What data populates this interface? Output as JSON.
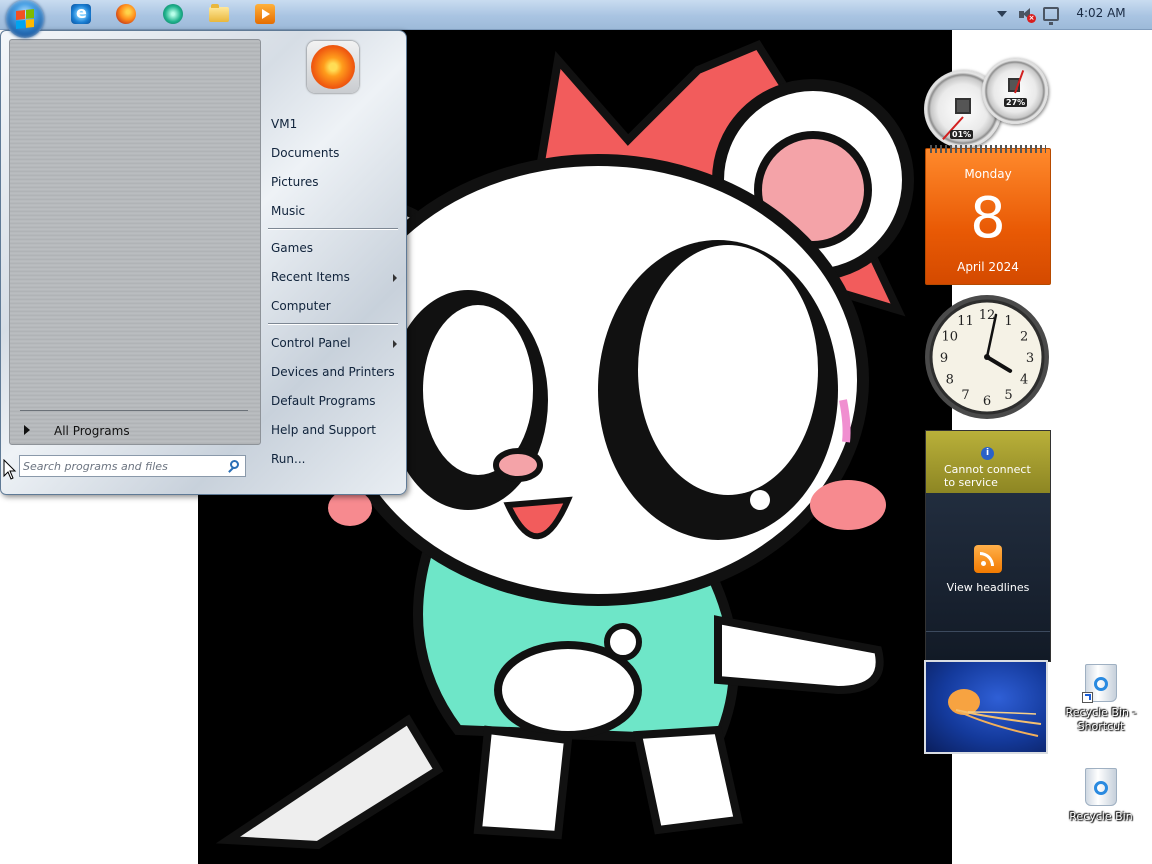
{
  "taskbar": {
    "pinned_icons": [
      "internet-explorer-icon",
      "firefox-icon",
      "media-player-icon",
      "windows-explorer-icon",
      "video-player-icon"
    ],
    "tray_icons": [
      "show-hidden-icons-chevron",
      "speaker-muted-icon",
      "network-icon"
    ],
    "clock": "4:02 AM"
  },
  "start_menu": {
    "all_programs": "All Programs",
    "search_placeholder": "Search programs and files",
    "right_items": [
      {
        "label": "VM1"
      },
      {
        "label": "Documents"
      },
      {
        "label": "Pictures"
      },
      {
        "label": "Music"
      },
      {
        "label": "Games"
      },
      {
        "label": "Recent Items",
        "submenu": true
      },
      {
        "label": "Computer"
      },
      {
        "label": "Control Panel",
        "submenu": true
      },
      {
        "label": "Devices and Printers"
      },
      {
        "label": "Default Programs"
      },
      {
        "label": "Help and Support"
      },
      {
        "label": "Run..."
      }
    ]
  },
  "gadgets": {
    "cpu_meter": {
      "cpu_percent": "01%",
      "memory_percent": "27%"
    },
    "calendar": {
      "day_name": "Monday",
      "day": "8",
      "month_year": "April 2024"
    },
    "clock": {
      "hour": 4,
      "minute": 2
    },
    "feeds": {
      "error": "Cannot connect to service",
      "headlines": "View headlines"
    }
  },
  "desktop_icons": [
    {
      "label": "Recycle Bin - Shortcut",
      "shortcut": true
    },
    {
      "label": "Recycle Bin",
      "shortcut": false
    }
  ],
  "colors": {
    "taskbar": "#b3cbe6",
    "calendar_orange": "#ff7a1a",
    "wallpaper_bg": "#000000"
  }
}
